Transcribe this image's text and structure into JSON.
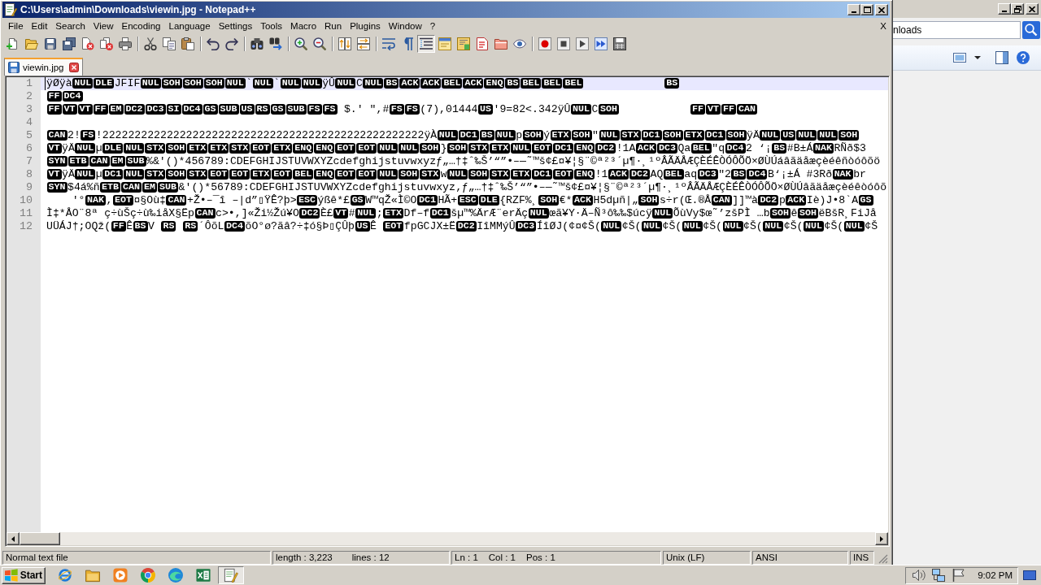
{
  "window": {
    "title": "C:\\Users\\admin\\Downloads\\viewin.jpg - Notepad++"
  },
  "menu": {
    "items": [
      "File",
      "Edit",
      "Search",
      "View",
      "Encoding",
      "Language",
      "Settings",
      "Tools",
      "Macro",
      "Run",
      "Plugins",
      "Window",
      "?"
    ],
    "close": "X"
  },
  "toolbar": [
    [
      {
        "kind": "new",
        "on": false
      },
      {
        "kind": "open",
        "on": false
      },
      {
        "kind": "save",
        "on": false
      },
      {
        "kind": "saveall",
        "on": false
      },
      {
        "kind": "close",
        "on": false
      },
      {
        "kind": "closeall",
        "on": false
      },
      {
        "kind": "print",
        "on": false
      }
    ],
    [
      {
        "kind": "cut",
        "on": false
      },
      {
        "kind": "copy",
        "on": false
      },
      {
        "kind": "paste",
        "on": false
      }
    ],
    [
      {
        "kind": "undo",
        "on": false
      },
      {
        "kind": "redo",
        "on": false
      }
    ],
    [
      {
        "kind": "find",
        "on": false
      },
      {
        "kind": "replace",
        "on": false
      }
    ],
    [
      {
        "kind": "zoomin",
        "on": false
      },
      {
        "kind": "zoomout",
        "on": false
      }
    ],
    [
      {
        "kind": "syncv",
        "on": false
      },
      {
        "kind": "synch",
        "on": false
      }
    ],
    [
      {
        "kind": "wrap",
        "on": false
      },
      {
        "kind": "allchars",
        "on": false
      },
      {
        "kind": "indent",
        "on": true
      },
      {
        "kind": "udl",
        "on": false
      },
      {
        "kind": "docmap",
        "on": false
      },
      {
        "kind": "funclist",
        "on": false
      },
      {
        "kind": "folder",
        "on": false
      },
      {
        "kind": "monitor",
        "on": false
      }
    ],
    [
      {
        "kind": "record",
        "on": false
      },
      {
        "kind": "stop",
        "on": false
      },
      {
        "kind": "play",
        "on": false
      },
      {
        "kind": "playmulti",
        "on": false
      },
      {
        "kind": "savemacro",
        "on": false
      }
    ]
  ],
  "tabs": [
    {
      "label": "viewin.jpg",
      "selected": true
    }
  ],
  "editor": {
    "lines": [
      {
        "number": "1",
        "current": true,
        "segments": [
          {
            "kind": "text",
            "text": "ÿØÿà"
          },
          {
            "kind": "ctrl",
            "text": "NUL"
          },
          {
            "kind": "ctrl",
            "text": "DLE"
          },
          {
            "kind": "text",
            "text": "JFIF"
          },
          {
            "kind": "ctrl",
            "text": "NUL"
          },
          {
            "kind": "ctrl",
            "text": "SOH"
          },
          {
            "kind": "ctrl",
            "text": "SOH"
          },
          {
            "kind": "ctrl",
            "text": "SOH"
          },
          {
            "kind": "ctrl",
            "text": "NUL"
          },
          {
            "kind": "text",
            "text": "`"
          },
          {
            "kind": "ctrl",
            "text": "NUL"
          },
          {
            "kind": "text",
            "text": "`"
          },
          {
            "kind": "ctrl",
            "text": "NUL"
          },
          {
            "kind": "ctrl",
            "text": "NUL"
          },
          {
            "kind": "text",
            "text": "ÿÛ"
          },
          {
            "kind": "ctrl",
            "text": "NUL"
          },
          {
            "kind": "text",
            "text": "C"
          },
          {
            "kind": "ctrl",
            "text": "NUL"
          },
          {
            "kind": "ctrl",
            "text": "BS"
          },
          {
            "kind": "ctrl",
            "text": "ACK"
          },
          {
            "kind": "ctrl",
            "text": "ACK"
          },
          {
            "kind": "ctrl",
            "text": "BEL"
          },
          {
            "kind": "ctrl",
            "text": "ACK"
          },
          {
            "kind": "ctrl",
            "text": "ENQ"
          },
          {
            "kind": "ctrl",
            "text": "BS"
          },
          {
            "kind": "ctrl",
            "text": "BEL"
          },
          {
            "kind": "ctrl",
            "text": "BEL"
          },
          {
            "kind": "ctrl",
            "text": "BEL"
          },
          {
            "kind": "tab"
          },
          {
            "kind": "tab"
          },
          {
            "kind": "tab"
          },
          {
            "kind": "ctrl",
            "text": "BS"
          }
        ]
      },
      {
        "number": "2",
        "current": false,
        "segments": [
          {
            "kind": "ctrl",
            "text": "FF"
          },
          {
            "kind": "ctrl",
            "text": "DC4"
          }
        ]
      },
      {
        "number": "3",
        "current": false,
        "segments": [
          {
            "kind": "ctrl",
            "text": "FF"
          },
          {
            "kind": "ctrl",
            "text": "VT"
          },
          {
            "kind": "ctrl",
            "text": "VT"
          },
          {
            "kind": "ctrl",
            "text": "FF"
          },
          {
            "kind": "ctrl",
            "text": "EM"
          },
          {
            "kind": "ctrl",
            "text": "DC2"
          },
          {
            "kind": "ctrl",
            "text": "DC3"
          },
          {
            "kind": "ctrl",
            "text": "SI"
          },
          {
            "kind": "ctrl",
            "text": "DC4"
          },
          {
            "kind": "ctrl",
            "text": "GS"
          },
          {
            "kind": "ctrl",
            "text": "SUB"
          },
          {
            "kind": "ctrl",
            "text": "US"
          },
          {
            "kind": "ctrl",
            "text": "RS"
          },
          {
            "kind": "ctrl",
            "text": "GS"
          },
          {
            "kind": "ctrl",
            "text": "SUB"
          },
          {
            "kind": "ctrl",
            "text": "FS"
          },
          {
            "kind": "ctrl",
            "text": "FS"
          },
          {
            "kind": "text",
            "text": " $.' \",#"
          },
          {
            "kind": "ctrl",
            "text": "FS"
          },
          {
            "kind": "ctrl",
            "text": "FS"
          },
          {
            "kind": "text",
            "text": "(7),01444"
          },
          {
            "kind": "ctrl",
            "text": "US"
          },
          {
            "kind": "text",
            "text": "'9=82<.342ÿÛ"
          },
          {
            "kind": "ctrl",
            "text": "NUL"
          },
          {
            "kind": "text",
            "text": "C"
          },
          {
            "kind": "ctrl",
            "text": "SOH"
          },
          {
            "kind": "tab"
          },
          {
            "kind": "tab"
          },
          {
            "kind": "tab"
          },
          {
            "kind": "ctrl",
            "text": "FF"
          },
          {
            "kind": "ctrl",
            "text": "VT"
          },
          {
            "kind": "ctrl",
            "text": "FF"
          },
          {
            "kind": "ctrl",
            "text": "CAN"
          }
        ]
      },
      {
        "number": "4",
        "current": false
      },
      {
        "number": "5",
        "current": false,
        "segments": [
          {
            "kind": "ctrl",
            "text": "CAN"
          },
          {
            "kind": "text",
            "text": "2!"
          },
          {
            "kind": "ctrl",
            "text": "FS"
          },
          {
            "kind": "text",
            "text": "!22222222222222222222222222222222222222222222222222ÿÀ"
          },
          {
            "kind": "ctrl",
            "text": "NUL"
          },
          {
            "kind": "ctrl",
            "text": "DC1"
          },
          {
            "kind": "ctrl",
            "text": "BS"
          },
          {
            "kind": "ctrl",
            "text": "NUL"
          },
          {
            "kind": "text",
            "text": "p"
          },
          {
            "kind": "ctrl",
            "text": "SOH"
          },
          {
            "kind": "text",
            "text": "ý"
          },
          {
            "kind": "ctrl",
            "text": "ETX"
          },
          {
            "kind": "ctrl",
            "text": "SOH"
          },
          {
            "kind": "text",
            "text": "\""
          },
          {
            "kind": "ctrl",
            "text": "NUL"
          },
          {
            "kind": "ctrl",
            "text": "STX"
          },
          {
            "kind": "ctrl",
            "text": "DC1"
          },
          {
            "kind": "ctrl",
            "text": "SOH"
          },
          {
            "kind": "ctrl",
            "text": "ETX"
          },
          {
            "kind": "ctrl",
            "text": "DC1"
          },
          {
            "kind": "ctrl",
            "text": "SOH"
          },
          {
            "kind": "text",
            "text": "ÿÄ"
          },
          {
            "kind": "ctrl",
            "text": "NUL"
          },
          {
            "kind": "ctrl",
            "text": "US"
          },
          {
            "kind": "ctrl",
            "text": "NUL"
          },
          {
            "kind": "ctrl",
            "text": "NUL"
          },
          {
            "kind": "ctrl",
            "text": "SOH"
          }
        ]
      },
      {
        "number": "6",
        "current": false,
        "segments": [
          {
            "kind": "ctrl",
            "text": "VT"
          },
          {
            "kind": "text",
            "text": "ÿÄ"
          },
          {
            "kind": "ctrl",
            "text": "NUL"
          },
          {
            "kind": "text",
            "text": "µ"
          },
          {
            "kind": "ctrl",
            "text": "DLE"
          },
          {
            "kind": "ctrl",
            "text": "NUL"
          },
          {
            "kind": "ctrl",
            "text": "STX"
          },
          {
            "kind": "ctrl",
            "text": "SOH"
          },
          {
            "kind": "ctrl",
            "text": "ETX"
          },
          {
            "kind": "ctrl",
            "text": "ETX"
          },
          {
            "kind": "ctrl",
            "text": "STX"
          },
          {
            "kind": "ctrl",
            "text": "EOT"
          },
          {
            "kind": "ctrl",
            "text": "ETX"
          },
          {
            "kind": "ctrl",
            "text": "ENQ"
          },
          {
            "kind": "ctrl",
            "text": "ENQ"
          },
          {
            "kind": "ctrl",
            "text": "EOT"
          },
          {
            "kind": "ctrl",
            "text": "EOT"
          },
          {
            "kind": "ctrl",
            "text": "NUL"
          },
          {
            "kind": "ctrl",
            "text": "NUL"
          },
          {
            "kind": "ctrl",
            "text": "SOH"
          },
          {
            "kind": "text",
            "text": "}"
          },
          {
            "kind": "ctrl",
            "text": "SOH"
          },
          {
            "kind": "ctrl",
            "text": "STX"
          },
          {
            "kind": "ctrl",
            "text": "ETX"
          },
          {
            "kind": "ctrl",
            "text": "NUL"
          },
          {
            "kind": "ctrl",
            "text": "EOT"
          },
          {
            "kind": "ctrl",
            "text": "DC1"
          },
          {
            "kind": "ctrl",
            "text": "ENQ"
          },
          {
            "kind": "ctrl",
            "text": "DC2"
          },
          {
            "kind": "text",
            "text": "!1A"
          },
          {
            "kind": "ctrl",
            "text": "ACK"
          },
          {
            "kind": "ctrl",
            "text": "DC3"
          },
          {
            "kind": "text",
            "text": "Qa"
          },
          {
            "kind": "ctrl",
            "text": "BEL"
          },
          {
            "kind": "text",
            "text": "\"q"
          },
          {
            "kind": "ctrl",
            "text": "DC4"
          },
          {
            "kind": "text",
            "text": "2 ‘¡"
          },
          {
            "kind": "ctrl",
            "text": "BS"
          },
          {
            "kind": "text",
            "text": "#B±Á"
          },
          {
            "kind": "ctrl",
            "text": "NAK"
          },
          {
            "kind": "text",
            "text": "RÑð$3"
          }
        ]
      },
      {
        "number": "7",
        "current": false,
        "segments": [
          {
            "kind": "ctrl",
            "text": "SYN"
          },
          {
            "kind": "ctrl",
            "text": "ETB"
          },
          {
            "kind": "ctrl",
            "text": "CAN"
          },
          {
            "kind": "ctrl",
            "text": "EM"
          },
          {
            "kind": "ctrl",
            "text": "SUB"
          },
          {
            "kind": "text",
            "text": "%&'()*456789:CDEFGHIJSTUVWXYZcdefghijstuvwxyzƒ„…†‡ˆ‰Š’“”•–—˜™š¢£¤¥¦§¨©ª²³´µ¶·¸¹ºÂÃÄÅÆÇÈÉÊÒÓÔÕÖ×ØÙÚáâãäåæçèéêñòóôõö"
          }
        ]
      },
      {
        "number": "8",
        "current": false,
        "segments": [
          {
            "kind": "ctrl",
            "text": "VT"
          },
          {
            "kind": "text",
            "text": "ÿÄ"
          },
          {
            "kind": "ctrl",
            "text": "NUL"
          },
          {
            "kind": "text",
            "text": "µ"
          },
          {
            "kind": "ctrl",
            "text": "DC1"
          },
          {
            "kind": "ctrl",
            "text": "NUL"
          },
          {
            "kind": "ctrl",
            "text": "STX"
          },
          {
            "kind": "ctrl",
            "text": "SOH"
          },
          {
            "kind": "ctrl",
            "text": "STX"
          },
          {
            "kind": "ctrl",
            "text": "EOT"
          },
          {
            "kind": "ctrl",
            "text": "EOT"
          },
          {
            "kind": "ctrl",
            "text": "ETX"
          },
          {
            "kind": "ctrl",
            "text": "EOT"
          },
          {
            "kind": "ctrl",
            "text": "BEL"
          },
          {
            "kind": "ctrl",
            "text": "ENQ"
          },
          {
            "kind": "ctrl",
            "text": "EOT"
          },
          {
            "kind": "ctrl",
            "text": "EOT"
          },
          {
            "kind": "ctrl",
            "text": "NUL"
          },
          {
            "kind": "ctrl",
            "text": "SOH"
          },
          {
            "kind": "ctrl",
            "text": "STX"
          },
          {
            "kind": "text",
            "text": "w"
          },
          {
            "kind": "ctrl",
            "text": "NUL"
          },
          {
            "kind": "ctrl",
            "text": "SOH"
          },
          {
            "kind": "ctrl",
            "text": "STX"
          },
          {
            "kind": "ctrl",
            "text": "ETX"
          },
          {
            "kind": "ctrl",
            "text": "DC1"
          },
          {
            "kind": "ctrl",
            "text": "EOT"
          },
          {
            "kind": "ctrl",
            "text": "ENQ"
          },
          {
            "kind": "text",
            "text": "!1"
          },
          {
            "kind": "ctrl",
            "text": "ACK"
          },
          {
            "kind": "ctrl",
            "text": "DC2"
          },
          {
            "kind": "text",
            "text": "AQ"
          },
          {
            "kind": "ctrl",
            "text": "BEL"
          },
          {
            "kind": "text",
            "text": "aq"
          },
          {
            "kind": "ctrl",
            "text": "DC3"
          },
          {
            "kind": "text",
            "text": "\"2"
          },
          {
            "kind": "ctrl",
            "text": "BS"
          },
          {
            "kind": "ctrl",
            "text": "DC4"
          },
          {
            "kind": "text",
            "text": "B‘¡±Á #3Rð"
          },
          {
            "kind": "ctrl",
            "text": "NAK"
          },
          {
            "kind": "text",
            "text": "br"
          }
        ]
      },
      {
        "number": "9",
        "current": false,
        "segments": [
          {
            "kind": "ctrl",
            "text": "SYN"
          },
          {
            "kind": "text",
            "text": "$4á%ñ"
          },
          {
            "kind": "ctrl",
            "text": "ETB"
          },
          {
            "kind": "ctrl",
            "text": "CAN"
          },
          {
            "kind": "ctrl",
            "text": "EM"
          },
          {
            "kind": "ctrl",
            "text": "SUB"
          },
          {
            "kind": "text",
            "text": "&'()*56789:CDEFGHIJSTUVWXYZcdefghijstuvwxyz‚ƒ„…†‡ˆ‰Š’“”•–—˜™š¢£¤¥¦§¨©ª²³´µ¶·¸¹ºÂÃÄÅÆÇÈÉÊÒÓÔÕÖ×ØÙÚâãäåæçèéêòóôõ"
          }
        ]
      },
      {
        "number": "10",
        "current": false,
        "segments": [
          {
            "kind": "tab"
          },
          {
            "kind": "text",
            "text": "'°"
          },
          {
            "kind": "ctrl",
            "text": "NAK"
          },
          {
            "kind": "text",
            "text": ","
          },
          {
            "kind": "ctrl",
            "text": "EOT"
          },
          {
            "kind": "text",
            "text": "¤§Où‡"
          },
          {
            "kind": "ctrl",
            "text": "CAN"
          },
          {
            "kind": "text",
            "text": "+Ž•–¯î –|d”▯ŸÊ?þ>"
          },
          {
            "kind": "ctrl",
            "text": "ESC"
          },
          {
            "kind": "text",
            "text": "ýßê*£"
          },
          {
            "kind": "ctrl",
            "text": "GS"
          },
          {
            "kind": "text",
            "text": "W™qŽ«Ì©O"
          },
          {
            "kind": "ctrl",
            "text": "DC1"
          },
          {
            "kind": "text",
            "text": "HÃ+"
          },
          {
            "kind": "ctrl",
            "text": "ESC"
          },
          {
            "kind": "ctrl",
            "text": "DLE"
          },
          {
            "kind": "text",
            "text": "{RZF%¸"
          },
          {
            "kind": "ctrl",
            "text": "SOH"
          },
          {
            "kind": "text",
            "text": "€*"
          },
          {
            "kind": "ctrl",
            "text": "ACK"
          },
          {
            "kind": "text",
            "text": "H5dµñ|„"
          },
          {
            "kind": "ctrl",
            "text": "SOH"
          },
          {
            "kind": "text",
            "text": "s÷r(Œ.®Å"
          },
          {
            "kind": "ctrl",
            "text": "CAN"
          },
          {
            "kind": "text",
            "text": "]]™à"
          },
          {
            "kind": "ctrl",
            "text": "DC2"
          },
          {
            "kind": "text",
            "text": "p"
          },
          {
            "kind": "ctrl",
            "text": "ACK"
          },
          {
            "kind": "text",
            "text": "Iè)J•8`A"
          },
          {
            "kind": "ctrl",
            "text": "GS"
          }
        ]
      },
      {
        "number": "11",
        "current": false,
        "segments": [
          {
            "kind": "text",
            "text": "Ì‡*ÅO¨8ª ç÷ùŠç÷ù‰iåX§Ëp"
          },
          {
            "kind": "ctrl",
            "text": "CAN"
          },
          {
            "kind": "text",
            "text": "c>•,]«Ži½Žú¥O"
          },
          {
            "kind": "ctrl",
            "text": "DC2"
          },
          {
            "kind": "text",
            "text": "È£"
          },
          {
            "kind": "ctrl",
            "text": "VT"
          },
          {
            "kind": "text",
            "text": "#"
          },
          {
            "kind": "ctrl",
            "text": "NUL"
          },
          {
            "kind": "text",
            "text": ";"
          },
          {
            "kind": "ctrl",
            "text": "ETX"
          },
          {
            "kind": "text",
            "text": "Df–f"
          },
          {
            "kind": "ctrl",
            "text": "DC1"
          },
          {
            "kind": "text",
            "text": "šµ™%ÄrÆ¨erÄç"
          },
          {
            "kind": "ctrl",
            "text": "NUL"
          },
          {
            "kind": "text",
            "text": "œã¥Y·Ä–Ñ³ô‰‰$úcÿ"
          },
          {
            "kind": "ctrl",
            "text": "NUL"
          },
          {
            "kind": "text",
            "text": "ÕùVy$œ˜’zšPÌ …b"
          },
          {
            "kind": "ctrl",
            "text": "SOH"
          },
          {
            "kind": "text",
            "text": "ê"
          },
          {
            "kind": "ctrl",
            "text": "SOH"
          },
          {
            "kind": "text",
            "text": "ëBšR¸FiJå"
          }
        ]
      },
      {
        "number": "12",
        "current": false,
        "segments": [
          {
            "kind": "text",
            "text": "UÜÁJ†;OQž("
          },
          {
            "kind": "ctrl",
            "text": "FF"
          },
          {
            "kind": "text",
            "text": "Ê"
          },
          {
            "kind": "ctrl",
            "text": "BS"
          },
          {
            "kind": "text",
            "text": "V "
          },
          {
            "kind": "ctrl",
            "text": "RS"
          },
          {
            "kind": "space"
          },
          {
            "kind": "ctrl",
            "text": "RS"
          },
          {
            "kind": "text",
            "text": "´ÔõL"
          },
          {
            "kind": "ctrl",
            "text": "DC4"
          },
          {
            "kind": "text",
            "text": "õO°ø?ãâ?÷‡ó§Þ▯ÇÛþ"
          },
          {
            "kind": "ctrl",
            "text": "US"
          },
          {
            "kind": "text",
            "text": "Ê "
          },
          {
            "kind": "ctrl",
            "text": "EOT"
          },
          {
            "kind": "text",
            "text": "fpGCJX±Ë"
          },
          {
            "kind": "ctrl",
            "text": "DC2"
          },
          {
            "kind": "text",
            "text": "IîMMýÛ"
          },
          {
            "kind": "ctrl",
            "text": "DC3"
          },
          {
            "kind": "text",
            "text": "ÍîØJ(¢¤¢Š("
          },
          {
            "kind": "ctrl",
            "text": "NUL"
          },
          {
            "kind": "text",
            "text": "¢Š("
          },
          {
            "kind": "ctrl",
            "text": "NUL"
          },
          {
            "kind": "text",
            "text": "¢Š("
          },
          {
            "kind": "ctrl",
            "text": "NUL"
          },
          {
            "kind": "text",
            "text": "¢Š("
          },
          {
            "kind": "ctrl",
            "text": "NUL"
          },
          {
            "kind": "text",
            "text": "¢Š("
          },
          {
            "kind": "ctrl",
            "text": "NUL"
          },
          {
            "kind": "text",
            "text": "¢Š("
          },
          {
            "kind": "ctrl",
            "text": "NUL"
          },
          {
            "kind": "text",
            "text": "¢Š("
          },
          {
            "kind": "ctrl",
            "text": "NUL"
          },
          {
            "kind": "text",
            "text": "¢Š"
          }
        ]
      }
    ]
  },
  "status_bar": {
    "file_type": "Normal text file",
    "length": "length : 3,223",
    "lines": "lines : 12",
    "line": "Ln : 1",
    "column": "Col : 1",
    "position": "Pos : 1",
    "eol": "Unix (LF)",
    "encoding": "ANSI",
    "mode": "INS"
  },
  "background_window": {
    "text_field": {
      "value": "nloads"
    }
  },
  "taskbar": {
    "start": "Start",
    "apps": [
      {
        "kind": "ie",
        "selected": false
      },
      {
        "kind": "folder",
        "selected": false
      },
      {
        "kind": "media",
        "selected": false
      },
      {
        "kind": "chrome",
        "selected": false
      },
      {
        "kind": "edge",
        "selected": false
      },
      {
        "kind": "excel",
        "selected": false
      },
      {
        "kind": "notepad",
        "selected": true
      }
    ],
    "clock": "9:02 PM"
  }
}
